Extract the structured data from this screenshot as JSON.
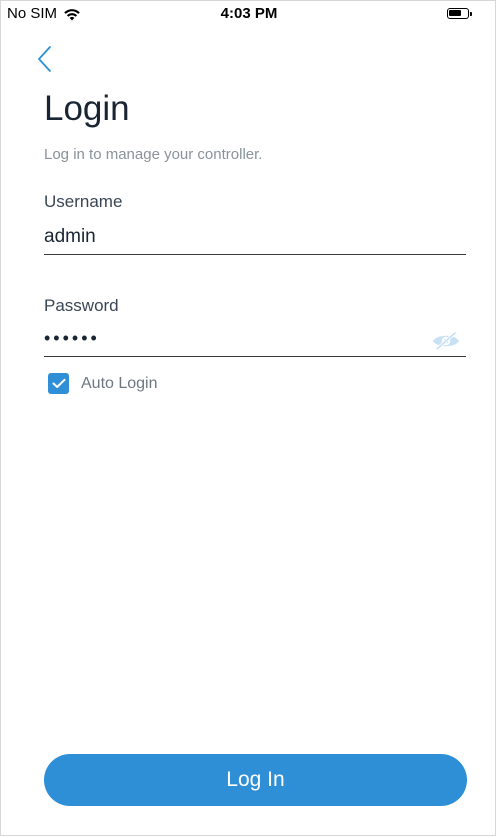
{
  "status_bar": {
    "carrier": "No SIM",
    "time": "4:03 PM",
    "wifi_icon": "wifi-icon",
    "battery_icon": "battery-icon"
  },
  "nav": {
    "back_icon": "chevron-left-icon"
  },
  "header": {
    "title": "Login",
    "subtitle": "Log in to manage your controller."
  },
  "form": {
    "username": {
      "label": "Username",
      "value": "admin"
    },
    "password": {
      "label": "Password",
      "value": "••••••",
      "visibility_icon": "eye-slash-icon"
    },
    "auto_login": {
      "label": "Auto Login",
      "checked": true
    }
  },
  "actions": {
    "login_label": "Log In"
  },
  "colors": {
    "accent": "#2f8fd6",
    "eye_icon": "#c9e1f5"
  }
}
